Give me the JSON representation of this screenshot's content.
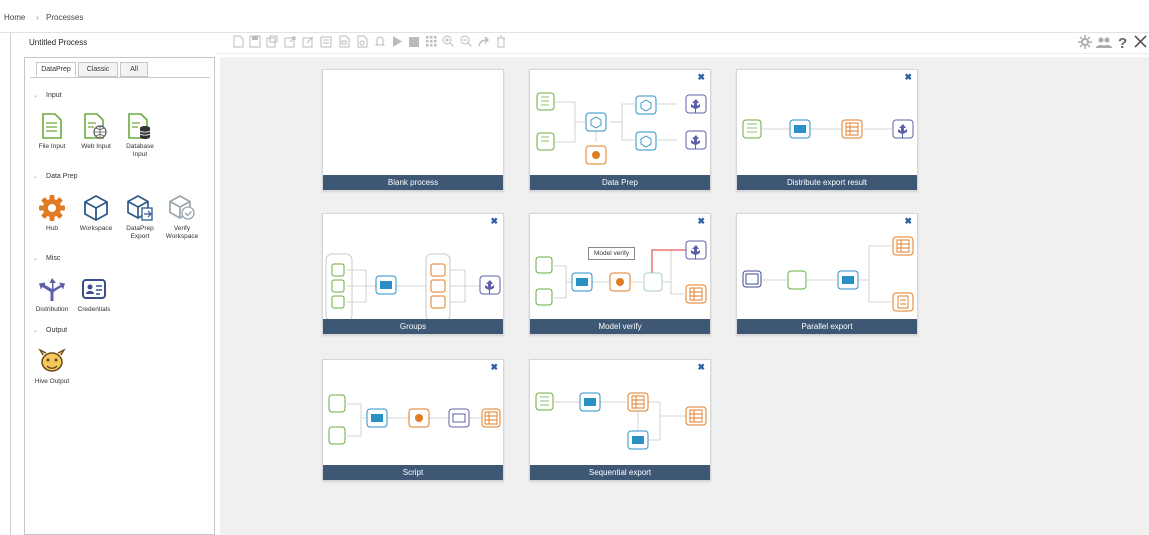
{
  "breadcrumb": {
    "home": "Home",
    "sep": "›",
    "current": "Processes"
  },
  "process": {
    "title": "Untitled Process"
  },
  "toolbar": {
    "icons": [
      "new-icon",
      "save-icon",
      "save-as-icon",
      "export-icon",
      "edit-icon",
      "run-list-icon",
      "document-icon",
      "document2-icon",
      "bell-icon",
      "play-icon",
      "stop-icon",
      "grid-icon",
      "zoom-in-icon",
      "zoom-out-icon",
      "redo-icon",
      "trash-icon"
    ],
    "right_icons": [
      "settings-icon",
      "users-icon",
      "help-icon",
      "close-icon"
    ]
  },
  "tabs": [
    "DataPrep",
    "Classic",
    "All"
  ],
  "sections": {
    "input": "Input",
    "dataprep": "Data Prep",
    "misc": "Misc",
    "output": "Output"
  },
  "tools": {
    "file_input": "File Input",
    "web_input": "Web Input",
    "database_input": "Database\nInput",
    "hub": "Hub",
    "workspace": "Workspace",
    "dataprep_export": "DataPrep\nExport",
    "verify_workspace": "Verify\nWorkspace",
    "distribution": "Distribution",
    "credentials": "Credentials",
    "hive_output": "Hive Output"
  },
  "templates": [
    "Blank process",
    "Data Prep",
    "Distribute export result",
    "Groups",
    "Model verify",
    "Parallel export",
    "Script",
    "Sequential export"
  ],
  "close_glyph": "✖",
  "tooltip": "Model verify",
  "colors": {
    "caption": "#3d5775",
    "green": "#6aab3c",
    "blue": "#2a8fc4",
    "orange": "#e07b23",
    "purple": "#5d5fa8",
    "close": "#2f5fa8"
  }
}
